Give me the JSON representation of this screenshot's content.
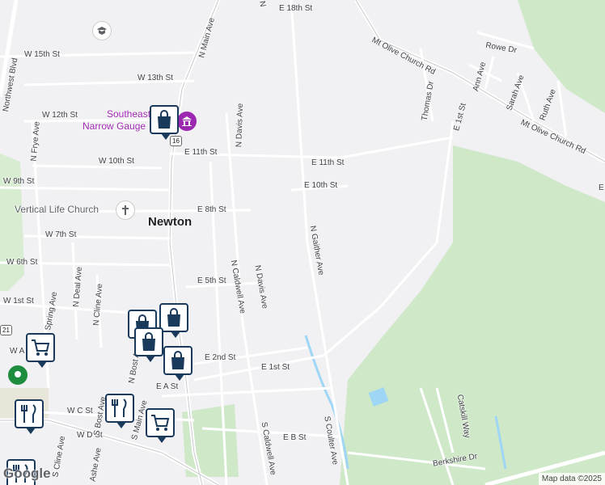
{
  "map": {
    "place": "Newton",
    "streets": [
      "E 18th St",
      "W 15th St",
      "W 13th St",
      "W 12th St",
      "E 11th St",
      "W 10th St",
      "W 9th St",
      "E 10th St",
      "E 8th St",
      "W 7th St",
      "W 6th St",
      "E 5th St",
      "W 1st St",
      "E 2nd St",
      "E 1st St",
      "E A St",
      "W C St",
      "W D St",
      "E B St",
      "N Main Ave",
      "N Davis Ave",
      "N Caldwell Ave",
      "N Gaither Ave",
      "N Frye Ave",
      "N Deal Ave",
      "N Cline Ave",
      "Spring Ave",
      "N Bost Ave",
      "S Bost Ave",
      "S Main Ave",
      "S Caldwell Ave",
      "S Coulter Ave",
      "S Cline Ave",
      "Ashe Ave",
      "Mt Olive Church Rd",
      "Mt Olive Church Rd",
      "Rowe Dr",
      "Ann Ave",
      "Sarah Ave",
      "Ruth Ave",
      "Thomas Dr",
      "E 1st St",
      "Catskill Way",
      "Berkshire Dr",
      "Northwest Blvd",
      "N",
      "W A",
      "E"
    ],
    "pois": {
      "museum_line1": "Southeast",
      "museum_line2": "Narrow Gauge",
      "church": "Vertical Life Church"
    },
    "route_shield": "16",
    "route_shield_2": "21",
    "google_logo": "Google",
    "attribution": "Map data ©2025",
    "pins": [
      "shopping-bag",
      "shopping-bag",
      "shopping-bag",
      "shopping-bag",
      "shopping-bag",
      "shopping-cart",
      "shopping-cart",
      "restaurant",
      "restaurant",
      "restaurant"
    ]
  }
}
